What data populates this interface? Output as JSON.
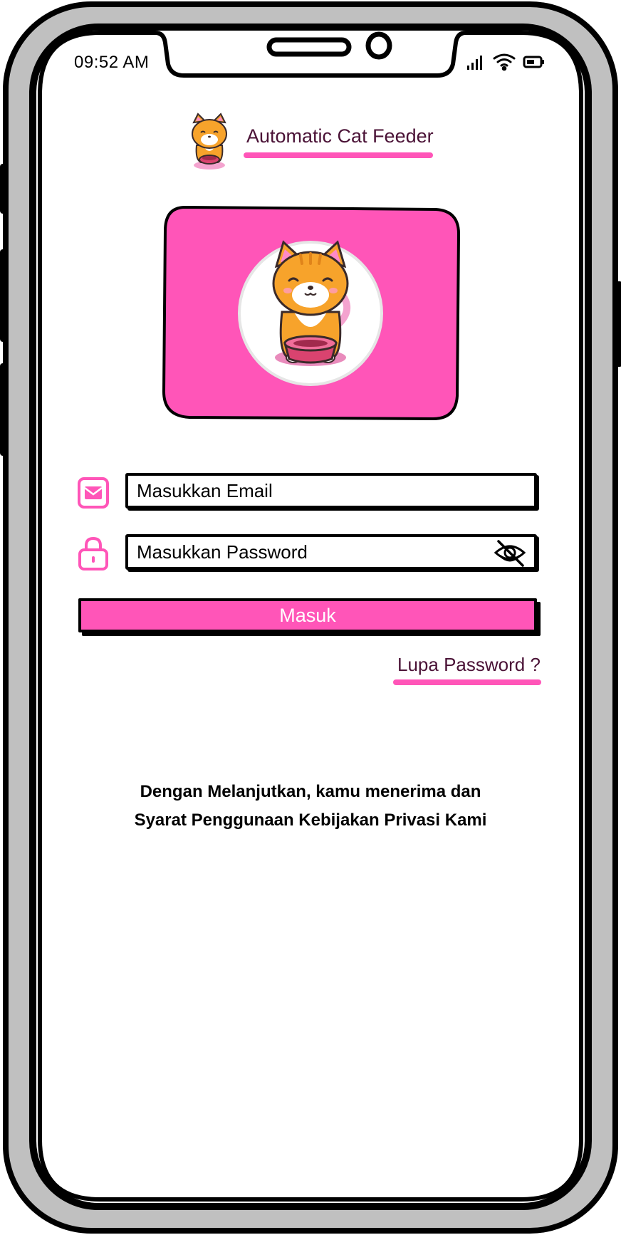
{
  "status_bar": {
    "time": "09:52 AM",
    "signal_icon": "signal-bars-icon",
    "wifi_icon": "wifi-icon",
    "battery_icon": "battery-icon"
  },
  "header": {
    "title": "Automatic Cat Feeder",
    "logo_icon": "cat-with-bowl-icon"
  },
  "hero": {
    "image_icon": "cat-with-bowl-illustration",
    "card_color": "#ff55b8"
  },
  "login_form": {
    "email": {
      "icon": "envelope-icon",
      "placeholder": "Masukkan Email",
      "value": ""
    },
    "password": {
      "icon": "lock-icon",
      "placeholder": "Masukkan Password",
      "value": "",
      "visibility_icon": "eye-off-icon"
    },
    "submit_label": "Masuk",
    "forgot_password_label": "Lupa Password ?"
  },
  "footer": {
    "terms_line_1": "Dengan Melanjutkan, kamu menerima dan",
    "terms_line_2": "Syarat Penggunaan Kebijakan Privasi Kami"
  },
  "colors": {
    "accent": "#ff55b8",
    "title_text": "#4a1236",
    "frame": "#c0c0c0",
    "outline": "#000000"
  }
}
